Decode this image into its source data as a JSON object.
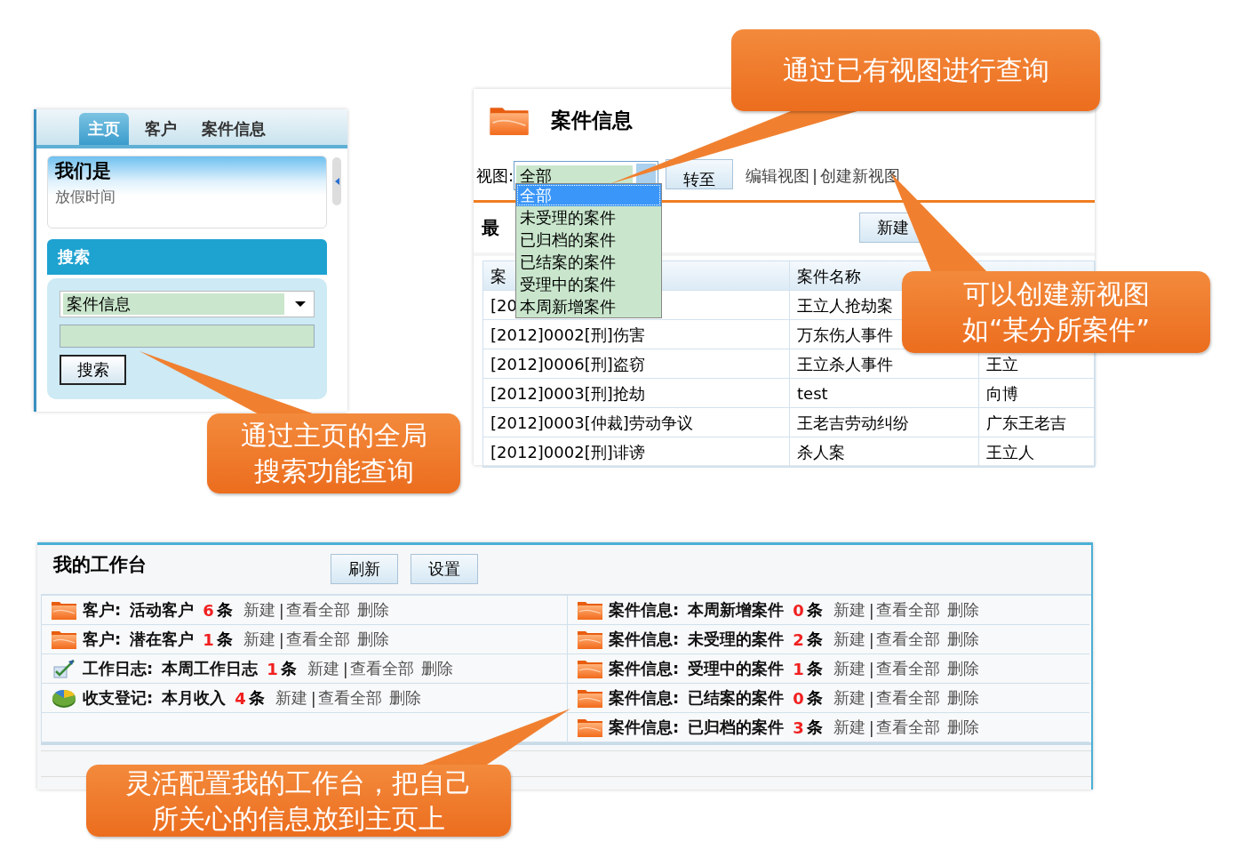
{
  "search_panel": {
    "tabs": [
      {
        "label": "主页",
        "selected": true
      },
      {
        "label": "客户",
        "selected": false
      },
      {
        "label": "案件信息",
        "selected": false
      }
    ],
    "notice": {
      "title": "我们是",
      "text": "放假时间"
    },
    "search": {
      "header": "搜索",
      "category": "案件信息",
      "button": "搜索"
    }
  },
  "case_panel": {
    "title": "案件信息",
    "view_label": "视图:",
    "view_select": "全部",
    "go_button": "转至",
    "links": [
      "编辑视图",
      "创建新视图"
    ],
    "link_separator": "|",
    "section_title": "最",
    "new_button": "新建",
    "view_options": [
      {
        "label": "全部",
        "selected": true
      },
      {
        "label": "未受理的案件",
        "selected": false
      },
      {
        "label": "已归档的案件",
        "selected": false
      },
      {
        "label": "已结案的案件",
        "selected": false
      },
      {
        "label": "受理中的案件",
        "selected": false
      },
      {
        "label": "本周新增案件",
        "selected": false
      }
    ],
    "table": {
      "columns": [
        "案",
        "案件名称"
      ],
      "rows": [
        [
          "[20",
          "王立人抢劫案"
        ],
        [
          "[2012]0002[刑]伤害",
          "万东伤人事件"
        ],
        [
          "[2012]0006[刑]盗窃",
          "王立杀人事件",
          "王立"
        ],
        [
          "[2012]0003[刑]抢劫",
          "test",
          "向博"
        ],
        [
          "[2012]0003[仲裁]劳动争议",
          "王老吉劳动纠纷",
          "广东王老吉"
        ],
        [
          "[2012]0002[刑]诽谤",
          "杀人案",
          "王立人"
        ]
      ]
    }
  },
  "workbench": {
    "title": "我的工作台",
    "buttons": [
      "刷新",
      "设置"
    ],
    "action_separator": "|",
    "columns": [
      [
        {
          "kind": "folder",
          "module": "客户:",
          "view": "活动客户",
          "count": "6",
          "unit": "条",
          "actions": [
            "新建",
            "查看全部",
            "删除"
          ]
        },
        {
          "kind": "folder",
          "module": "客户:",
          "view": "潜在客户",
          "count": "1",
          "unit": "条",
          "actions": [
            "新建",
            "查看全部",
            "删除"
          ]
        },
        {
          "kind": "journal",
          "module": "工作日志:",
          "view": "本周工作日志",
          "count": "1",
          "unit": "条",
          "actions": [
            "新建",
            "查看全部",
            "删除"
          ]
        },
        {
          "kind": "pie",
          "module": "收支登记:",
          "view": "本月收入",
          "count": "4",
          "unit": "条",
          "actions": [
            "新建",
            "查看全部",
            "删除"
          ]
        }
      ],
      [
        {
          "kind": "folder",
          "module": "案件信息:",
          "view": "本周新增案件",
          "count": "0",
          "unit": "条",
          "actions": [
            "新建",
            "查看全部",
            "删除"
          ]
        },
        {
          "kind": "folder",
          "module": "案件信息:",
          "view": "未受理的案件",
          "count": "2",
          "unit": "条",
          "actions": [
            "新建",
            "查看全部",
            "删除"
          ]
        },
        {
          "kind": "folder",
          "module": "案件信息:",
          "view": "受理中的案件",
          "count": "1",
          "unit": "条",
          "actions": [
            "新建",
            "查看全部",
            "删除"
          ]
        },
        {
          "kind": "folder",
          "module": "案件信息:",
          "view": "已结案的案件",
          "count": "0",
          "unit": "条",
          "actions": [
            "新建",
            "查看全部",
            "删除"
          ]
        },
        {
          "kind": "folder",
          "module": "案件信息:",
          "view": "已归档的案件",
          "count": "3",
          "unit": "条",
          "actions": [
            "新建",
            "查看全部",
            "删除"
          ]
        }
      ]
    ]
  },
  "callouts": [
    {
      "lines": [
        "通过已有视图进行查询"
      ]
    },
    {
      "lines": [
        "可以创建新视图",
        "如“某分所案件”"
      ]
    },
    {
      "lines": [
        "通过主页的全局",
        "搜索功能查询"
      ]
    },
    {
      "lines": [
        "灵活配置我的工作台，把自己",
        "所关心的信息放到主页上"
      ]
    }
  ]
}
